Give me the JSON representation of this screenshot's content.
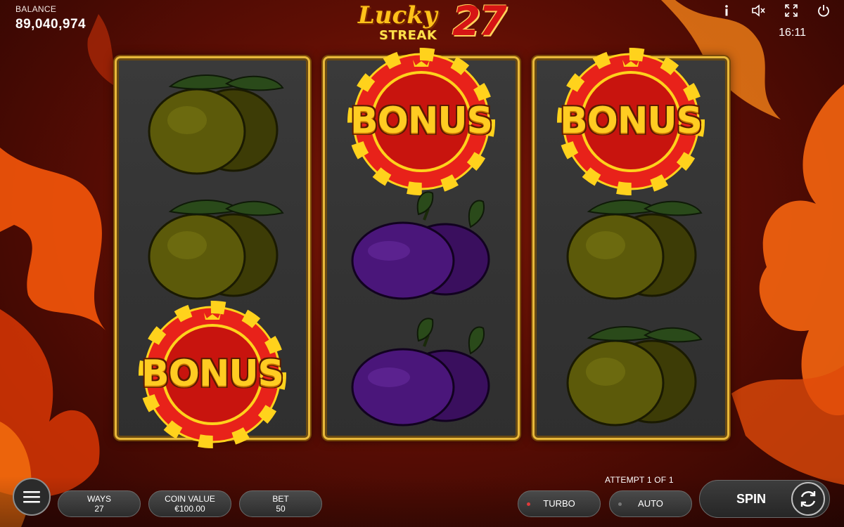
{
  "header": {
    "balance_label": "BALANCE",
    "balance_value": "89,040,974",
    "clock": "16:11",
    "icons": [
      "info-icon",
      "mute-icon",
      "fullscreen-icon",
      "power-icon"
    ]
  },
  "logo": {
    "word1": "Lucky",
    "word2": "STREAK",
    "number": "27"
  },
  "reels": [
    [
      "lemon",
      "lemon",
      "bonus"
    ],
    [
      "bonus",
      "plum",
      "plum"
    ],
    [
      "bonus",
      "lemon",
      "lemon"
    ]
  ],
  "bonus_text": "BONUS",
  "controls": {
    "attempt": "ATTEMPT 1 OF 1",
    "ways_label": "WAYS",
    "ways_value": "27",
    "coin_label": "COIN VALUE",
    "coin_value": "€100.00",
    "bet_label": "BET",
    "bet_value": "50",
    "turbo_label": "TURBO",
    "auto_label": "AUTO",
    "spin_label": "SPIN"
  },
  "colors": {
    "reel_border": "#e8b83a",
    "chip_red": "#e8221a",
    "chip_yellow": "#ffd21c",
    "lemon": "#5c5a0a",
    "plum": "#3f1266",
    "turbo_dot": "#e03a3a",
    "auto_dot": "#777777"
  }
}
